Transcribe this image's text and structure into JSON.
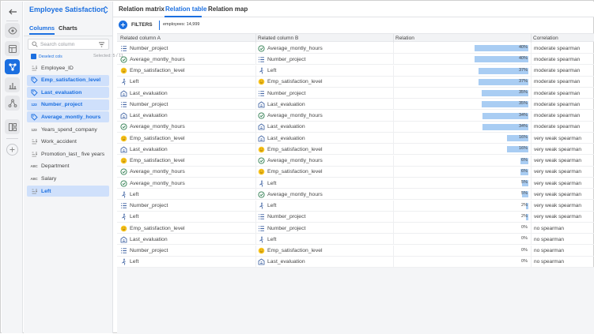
{
  "colors": {
    "accent": "#1b6fe0",
    "selected_bg": "#cfe0fb",
    "relation_bar": "#a9cdf3"
  },
  "rail": {
    "items": [
      {
        "name": "back-icon",
        "active": false
      },
      {
        "name": "eye-icon",
        "active": false
      },
      {
        "name": "layout-icon",
        "active": false
      },
      {
        "name": "relations-icon",
        "active": true
      },
      {
        "name": "bar-chart-icon",
        "active": false
      },
      {
        "name": "network-icon",
        "active": false
      },
      {
        "name": "dashboard-icon",
        "active": false
      },
      {
        "name": "plus-icon",
        "active": false
      }
    ]
  },
  "sidebar": {
    "dataset_title": "Employee Satisfaction",
    "tabs": {
      "columns": "Columns",
      "charts": "Charts"
    },
    "search_placeholder": "Search column",
    "deselect_label": "Deselect cols",
    "selected_count": "Selected: 5 / 11",
    "columns": [
      {
        "label": "Employee_ID",
        "icon": "sort-icon",
        "selected": false
      },
      {
        "label": "Emp_satisfaction_level",
        "icon": "tag-icon",
        "selected": true
      },
      {
        "label": "Last_evaluation",
        "icon": "tag-icon",
        "selected": true
      },
      {
        "label": "Number_project",
        "icon": "numeric-icon",
        "icon_text": "123",
        "selected": true
      },
      {
        "label": "Average_montly_hours",
        "icon": "tag-icon",
        "selected": true
      },
      {
        "label": "Years_spend_company",
        "icon": "numeric-icon",
        "icon_text": "123",
        "selected": false
      },
      {
        "label": "Work_accident",
        "icon": "sort-icon",
        "selected": false
      },
      {
        "label": "Promotion_last_ five years",
        "icon": "sort-icon",
        "selected": false
      },
      {
        "label": "Department",
        "icon": "text-icon",
        "icon_text": "ABC",
        "selected": false
      },
      {
        "label": "Salary",
        "icon": "text-icon",
        "icon_text": "ABC",
        "selected": false
      },
      {
        "label": "Left",
        "icon": "sort-icon",
        "selected": true
      }
    ]
  },
  "top_tabs": [
    {
      "label": "Relation matrix",
      "active": false
    },
    {
      "label": "Relation table",
      "active": true
    },
    {
      "label": "Relation map",
      "active": false
    }
  ],
  "filters": {
    "label": "FILTERS",
    "chip": "employees: 14,999"
  },
  "table": {
    "headers": [
      "Related column A",
      "Related column B",
      "Relation",
      "Correlation"
    ],
    "rows": [
      {
        "a": "Number_project",
        "a_icon": "list-icon",
        "b": "Average_montly_hours",
        "b_icon": "clock-icon",
        "relation": 40,
        "relation_label": "40%",
        "correlation": "moderate spearman"
      },
      {
        "a": "Average_montly_hours",
        "a_icon": "clock-icon",
        "b": "Number_project",
        "b_icon": "list-icon",
        "relation": 40,
        "relation_label": "40%",
        "correlation": "moderate spearman"
      },
      {
        "a": "Emp_satisfaction_level",
        "a_icon": "smiley-icon",
        "b": "Left",
        "b_icon": "exit-icon",
        "relation": 37,
        "relation_label": "37%",
        "correlation": "moderate spearman"
      },
      {
        "a": "Left",
        "a_icon": "exit-icon",
        "b": "Emp_satisfaction_level",
        "b_icon": "smiley-icon",
        "relation": 37,
        "relation_label": "37%",
        "correlation": "moderate spearman"
      },
      {
        "a": "Last_evaluation",
        "a_icon": "evaluation-icon",
        "b": "Number_project",
        "b_icon": "list-icon",
        "relation": 35,
        "relation_label": "35%",
        "correlation": "moderate spearman"
      },
      {
        "a": "Number_project",
        "a_icon": "list-icon",
        "b": "Last_evaluation",
        "b_icon": "evaluation-icon",
        "relation": 35,
        "relation_label": "35%",
        "correlation": "moderate spearman"
      },
      {
        "a": "Last_evaluation",
        "a_icon": "evaluation-icon",
        "b": "Average_montly_hours",
        "b_icon": "clock-icon",
        "relation": 34,
        "relation_label": "34%",
        "correlation": "moderate spearman"
      },
      {
        "a": "Average_montly_hours",
        "a_icon": "clock-icon",
        "b": "Last_evaluation",
        "b_icon": "evaluation-icon",
        "relation": 34,
        "relation_label": "34%",
        "correlation": "moderate spearman"
      },
      {
        "a": "Emp_satisfaction_level",
        "a_icon": "smiley-icon",
        "b": "Last_evaluation",
        "b_icon": "evaluation-icon",
        "relation": 16,
        "relation_label": "16%",
        "correlation": "very weak spearman"
      },
      {
        "a": "Last_evaluation",
        "a_icon": "evaluation-icon",
        "b": "Emp_satisfaction_level",
        "b_icon": "smiley-icon",
        "relation": 16,
        "relation_label": "16%",
        "correlation": "very weak spearman"
      },
      {
        "a": "Emp_satisfaction_level",
        "a_icon": "smiley-icon",
        "b": "Average_montly_hours",
        "b_icon": "clock-icon",
        "relation": 6,
        "relation_label": "6%",
        "correlation": "very weak spearman"
      },
      {
        "a": "Average_montly_hours",
        "a_icon": "clock-icon",
        "b": "Emp_satisfaction_level",
        "b_icon": "smiley-icon",
        "relation": 6,
        "relation_label": "6%",
        "correlation": "very weak spearman"
      },
      {
        "a": "Average_montly_hours",
        "a_icon": "clock-icon",
        "b": "Left",
        "b_icon": "exit-icon",
        "relation": 5,
        "relation_label": "5%",
        "correlation": "very weak spearman"
      },
      {
        "a": "Left",
        "a_icon": "exit-icon",
        "b": "Average_montly_hours",
        "b_icon": "clock-icon",
        "relation": 5,
        "relation_label": "5%",
        "correlation": "very weak spearman"
      },
      {
        "a": "Number_project",
        "a_icon": "list-icon",
        "b": "Left",
        "b_icon": "exit-icon",
        "relation": 2,
        "relation_label": "2%",
        "correlation": "very weak spearman"
      },
      {
        "a": "Left",
        "a_icon": "exit-icon",
        "b": "Number_project",
        "b_icon": "list-icon",
        "relation": 2,
        "relation_label": "2%",
        "correlation": "very weak spearman"
      },
      {
        "a": "Emp_satisfaction_level",
        "a_icon": "smiley-icon",
        "b": "Number_project",
        "b_icon": "list-icon",
        "relation": 0,
        "relation_label": "0%",
        "correlation": "no spearman"
      },
      {
        "a": "Last_evaluation",
        "a_icon": "evaluation-icon",
        "b": "Left",
        "b_icon": "exit-icon",
        "relation": 0,
        "relation_label": "0%",
        "correlation": "no spearman"
      },
      {
        "a": "Number_project",
        "a_icon": "list-icon",
        "b": "Emp_satisfaction_level",
        "b_icon": "smiley-icon",
        "relation": 0,
        "relation_label": "0%",
        "correlation": "no spearman"
      },
      {
        "a": "Left",
        "a_icon": "exit-icon",
        "b": "Last_evaluation",
        "b_icon": "evaluation-icon",
        "relation": 0,
        "relation_label": "0%",
        "correlation": "no spearman"
      }
    ]
  }
}
